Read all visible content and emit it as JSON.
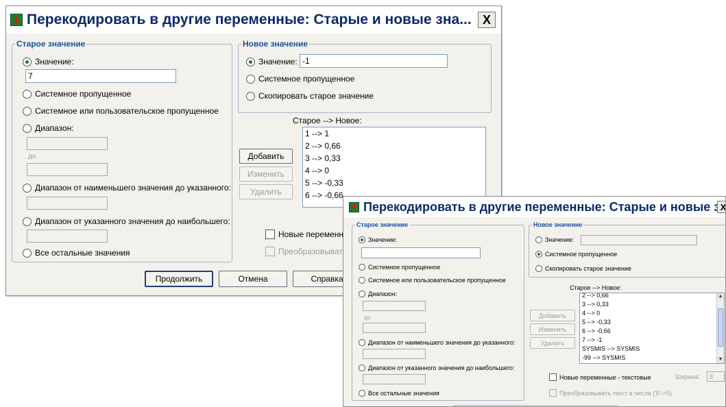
{
  "dialog1": {
    "title": "Перекодировать в другие переменные: Старые и новые зна...",
    "close_label": "X",
    "old_group": {
      "legend": "Старое значение",
      "value_label": "Значение:",
      "value_input": "7",
      "system_missing": "Системное пропущенное",
      "system_or_user_missing": "Системное или пользовательское пропущенное",
      "range": "Диапазон:",
      "range_through": "до",
      "range_lowest": "Диапазон от наименьшего значения до указанного:",
      "range_highest": "Диапазон от указанного значения до наибольшего:",
      "all_other": "Все остальные значения"
    },
    "new_group": {
      "legend": "Новое значение",
      "value_label": "Значение:",
      "value_input": "-1",
      "system_missing": "Системное пропущенное",
      "copy_old": "Скопировать старое значение"
    },
    "mapping_label": "Старое --> Новое:",
    "mappings": [
      "1 --> 1",
      "2 --> 0,66",
      "3 --> 0,33",
      "4 --> 0",
      "5 --> -0,33",
      "6 --> -0,66"
    ],
    "add_button": "Добавить",
    "change_button": "Изменить",
    "remove_button": "Удалить",
    "string_output": "Новые переменные",
    "convert_numeric": "Преобразовывать",
    "continue_button": "Продолжить",
    "cancel_button": "Отмена",
    "help_button": "Справка"
  },
  "dialog2": {
    "title": "Перекодировать в другие переменные: Старые и новые зна...",
    "close_label": "X",
    "old_group": {
      "legend": "Старое значение",
      "value_label": "Значение:",
      "value_input": "",
      "system_missing": "Системное пропущенное",
      "system_or_user_missing": "Системное или пользовательское пропущенное",
      "range": "Диапазон:",
      "range_through": "до",
      "range_lowest": "Диапазон от наименьшего значения до указанного:",
      "range_highest": "Диапазон от указанного значения до наибольшего:",
      "all_other": "Все остальные значения"
    },
    "new_group": {
      "legend": "Новое значение",
      "value_label": "Значение:",
      "value_input": "",
      "system_missing": "Системное пропущенное",
      "copy_old": "Скопировать старое значение"
    },
    "mapping_label": "Старое --> Новое:",
    "mappings": [
      "2 --> 0,66",
      "3 --> 0,33",
      "4 --> 0",
      "5 --> -0,33",
      "6 --> -0,66",
      "7 --> -1",
      "SYSMIS --> SYSMIS",
      "-99 --> SYSMIS"
    ],
    "add_button": "Добавить",
    "change_button": "Изменить",
    "remove_button": "Удалить",
    "string_output": "Новые переменные - текстовые",
    "width_label": "Ширина:",
    "width_value": "8",
    "convert_numeric": "Преобразовывать текст в числа ('5'->5)"
  },
  "icons": {
    "app": "spss-recode-icon",
    "close": "close-icon"
  }
}
